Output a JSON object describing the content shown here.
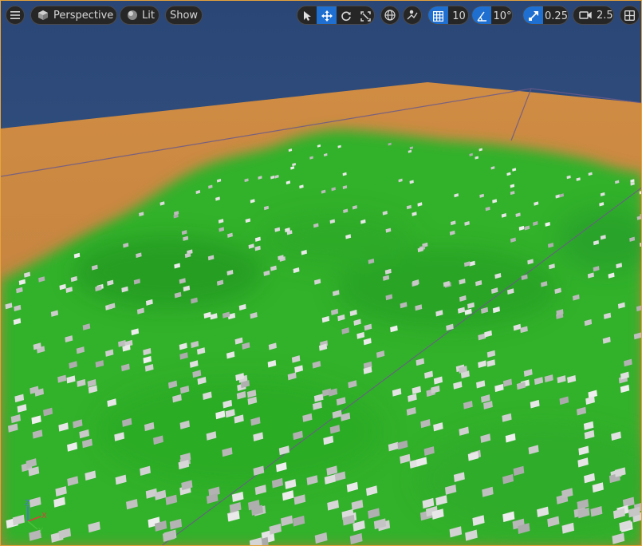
{
  "viewport": {
    "view_mode_label": "Perspective",
    "lighting_label": "Lit",
    "show_label": "Show",
    "grid_snap_value": "10",
    "rotation_snap_value": "10°",
    "scale_snap_value": "0.25",
    "camera_speed_value": "2.5",
    "axis_labels": {
      "z": "Z",
      "x": "X",
      "y": "Y"
    }
  },
  "colors": {
    "sky": "#2d4a7c",
    "ground": "#c98a45",
    "foliage": "#2fb42a",
    "accent": "#1f6fd1",
    "toolbar_bg": "#262626"
  },
  "icons": [
    "hamburger-menu-icon",
    "perspective-cube-icon",
    "lit-sphere-icon",
    "select-arrow-icon",
    "move-arrows-icon",
    "rotate-icon",
    "scale-icon",
    "world-globe-icon",
    "surface-snap-icon",
    "grid-icon",
    "angle-icon",
    "scale-snap-icon",
    "camera-icon",
    "maximize-grid-icon"
  ]
}
